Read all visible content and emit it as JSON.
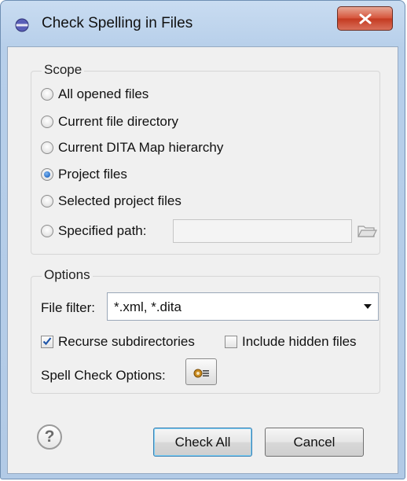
{
  "window": {
    "title": "Check Spelling in Files"
  },
  "scope": {
    "legend": "Scope",
    "options": [
      {
        "label": "All opened files",
        "selected": false
      },
      {
        "label": "Current file directory",
        "selected": false
      },
      {
        "label": "Current DITA Map hierarchy",
        "selected": false
      },
      {
        "label": "Project files",
        "selected": true
      },
      {
        "label": "Selected project files",
        "selected": false
      },
      {
        "label": "Specified path:",
        "selected": false
      }
    ],
    "specified_path_value": ""
  },
  "options": {
    "legend": "Options",
    "file_filter_label": "File filter:",
    "file_filter_value": "*.xml, *.dita",
    "recurse_label": "Recurse subdirectories",
    "recurse_checked": true,
    "hidden_label": "Include hidden files",
    "hidden_checked": false,
    "spell_check_label": "Spell Check Options:"
  },
  "footer": {
    "help_glyph": "?",
    "check_all_label": "Check All",
    "cancel_label": "Cancel"
  },
  "colors": {
    "accent": "#2a6fc8",
    "close": "#c43a21"
  }
}
